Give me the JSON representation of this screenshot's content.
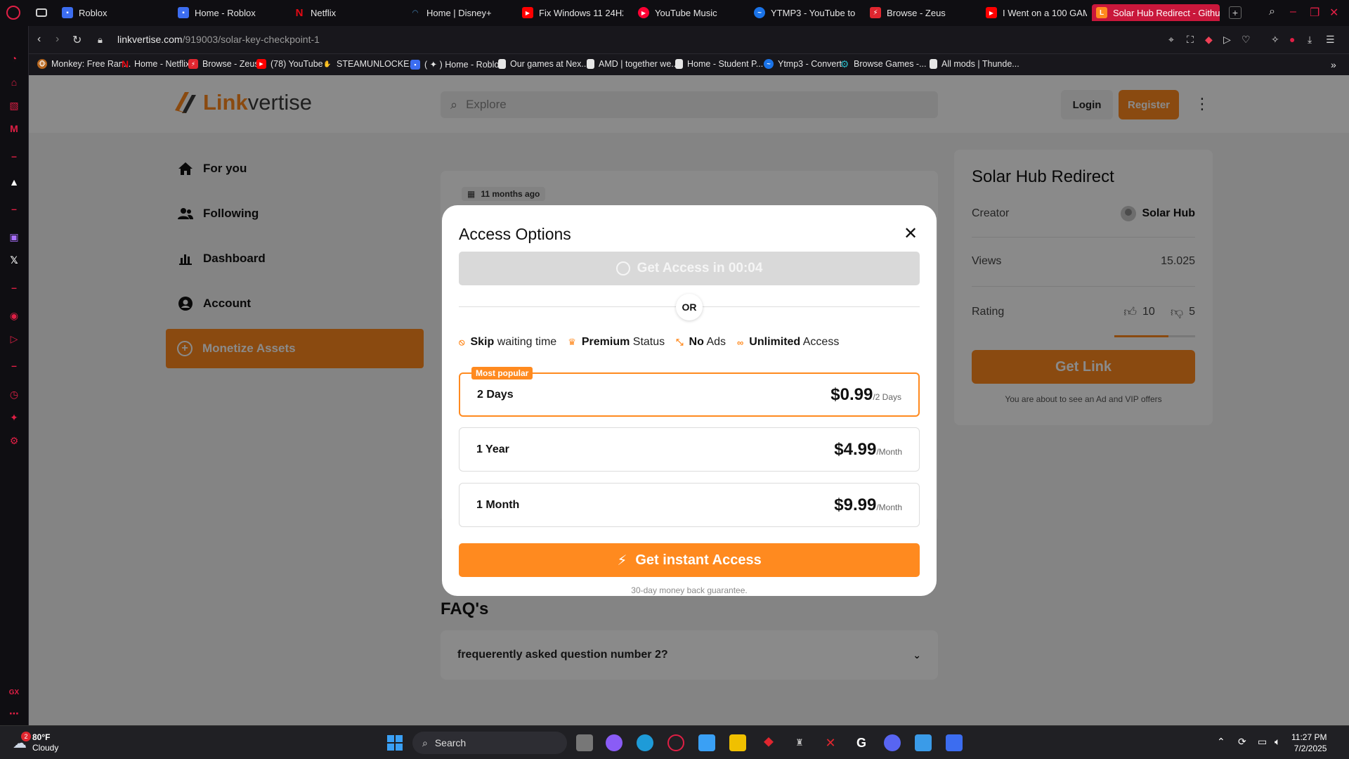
{
  "browser": {
    "tabs": [
      {
        "title": "Roblox",
        "icon": "roblox-icon",
        "color": "#3c6df0"
      },
      {
        "title": "Home - Roblox",
        "icon": "roblox-icon",
        "color": "#3c6df0"
      },
      {
        "title": "Netflix",
        "icon": "netflix-icon",
        "color": "#e50914"
      },
      {
        "title": "Home | Disney+",
        "icon": "disney-icon",
        "color": "#1a4a8a"
      },
      {
        "title": "Fix Windows 11 24H2",
        "icon": "youtube-icon",
        "color": "#ff0000"
      },
      {
        "title": "YouTube Music",
        "icon": "youtube-music-icon",
        "color": "#ff0033"
      },
      {
        "title": "YTMP3 - YouTube to",
        "icon": "ytmp3-icon",
        "color": "#1a73e8"
      },
      {
        "title": "Browse - Zeus",
        "icon": "zeus-icon",
        "color": "#e0262f"
      },
      {
        "title": "I Went on a 100 GAM",
        "icon": "youtube-icon",
        "color": "#ff0000"
      },
      {
        "title": "Solar Hub Redirect - Githu",
        "icon": "linkvertise-icon",
        "color": "#ff8a1f"
      }
    ],
    "url": {
      "host": "linkvertise.com",
      "path": "/919003/solar-key-checkpoint-1"
    },
    "bookmarks": [
      {
        "title": "Monkey: Free Ran...",
        "color": "#b5651d"
      },
      {
        "title": "Home - Netflix",
        "color": "#e50914"
      },
      {
        "title": "Browse - Zeus",
        "color": "#e0262f"
      },
      {
        "title": "(78) YouTube",
        "color": "#ff0000"
      },
      {
        "title": "STEAMUNLOCKE...",
        "color": "#e0262f"
      },
      {
        "title": "( ✦ ) Home - Roblox",
        "color": "#3c6df0"
      },
      {
        "title": "Our games at Nex...",
        "color": "#e6e6e6"
      },
      {
        "title": "AMD | together we...",
        "color": "#e6e6e6"
      },
      {
        "title": "Home - Student P...",
        "color": "#e6e6e6"
      },
      {
        "title": "Ytmp3 - Convert",
        "color": "#1a73e8"
      },
      {
        "title": "Browse Games -...",
        "color": "#2bb3c0"
      },
      {
        "title": "All mods | Thunde...",
        "color": "#e6e6e6"
      }
    ]
  },
  "site": {
    "logo": {
      "part1": "Link",
      "part2": "vertise"
    },
    "search_placeholder": "Explore",
    "login": "Login",
    "register": "Register",
    "nav": [
      {
        "label": "For you",
        "icon": "home-icon"
      },
      {
        "label": "Following",
        "icon": "people-icon"
      },
      {
        "label": "Dashboard",
        "icon": "bar-chart-icon"
      },
      {
        "label": "Account",
        "icon": "account-icon"
      }
    ],
    "monetize": "Monetize Assets",
    "date_chip": "11 months ago",
    "faq_title": "FAQ's",
    "faq_item": "frequerently asked question number 2?",
    "side": {
      "title": "Solar Hub Redirect",
      "creator_label": "Creator",
      "creator_name": "Solar Hub",
      "views_label": "Views",
      "views_value": "15.025",
      "rating_label": "Rating",
      "likes": "10",
      "dislikes": "5",
      "rating_fraction": 0.67,
      "get_link": "Get Link",
      "note": "You are about to see an Ad and VIP offers"
    }
  },
  "modal": {
    "title": "Access Options",
    "timer": "Get Access in 00:04",
    "or": "OR",
    "features": [
      {
        "bold": "Skip",
        "rest": " waiting time"
      },
      {
        "bold": "Premium",
        "rest": " Status"
      },
      {
        "bold": "No",
        "rest": " Ads"
      },
      {
        "bold": "Unlimited",
        "rest": " Access"
      }
    ],
    "plans": [
      {
        "name": "2 Days",
        "price": "$0.99",
        "period": "/2 Days",
        "badge": "Most popular"
      },
      {
        "name": "1 Year",
        "price": "$4.99",
        "period": "/Month"
      },
      {
        "name": "1 Month",
        "price": "$9.99",
        "period": "/Month"
      }
    ],
    "cta": "Get instant Access",
    "note": "30-day money back guarantee."
  },
  "taskbar": {
    "weather_temp": "80°F",
    "weather_desc": "Cloudy",
    "weather_badge": "2",
    "search": "Search",
    "time": "11:27 PM",
    "date": "7/2/2025"
  },
  "colors": {
    "accent": "#ff8a1f",
    "opera_red": "#e01f45",
    "active_tab": "#c9173b"
  }
}
